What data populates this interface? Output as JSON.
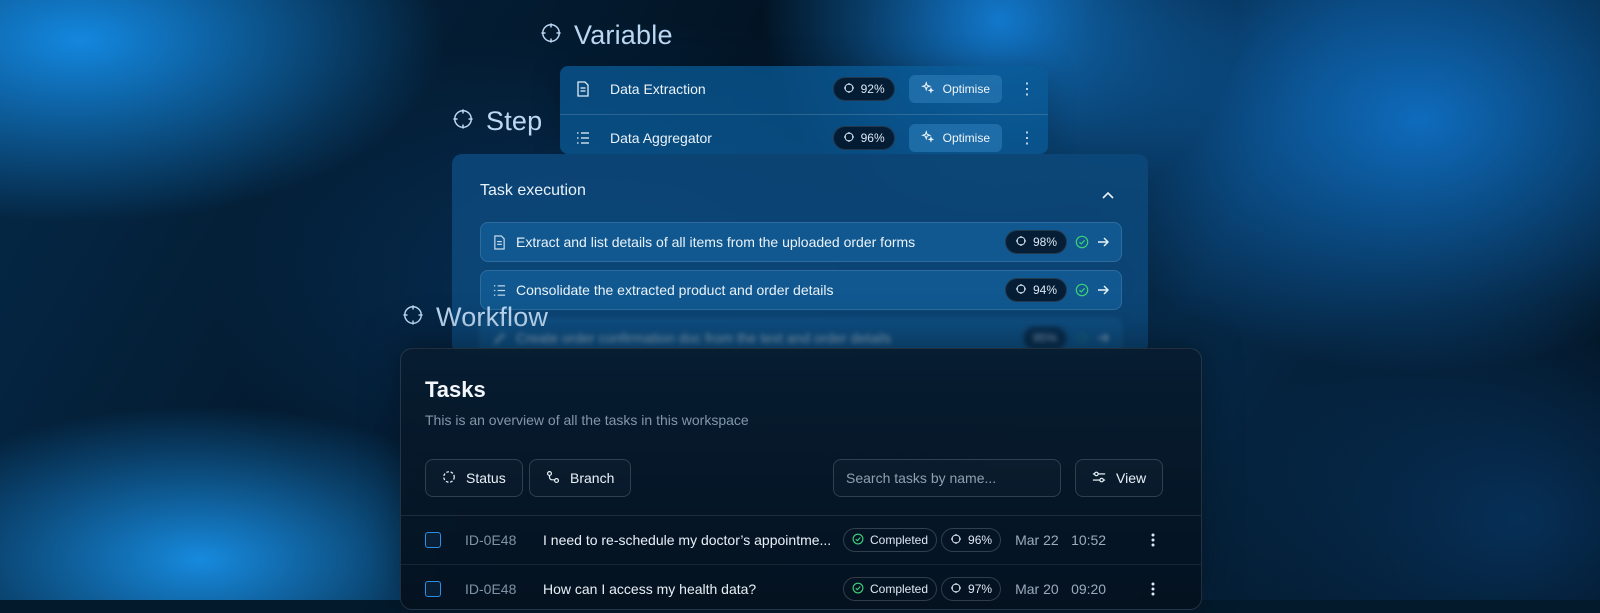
{
  "layers": {
    "variable": "Variable",
    "step": "Step",
    "workflow": "Workflow"
  },
  "variable_card": {
    "rows": [
      {
        "label": "Data Extraction",
        "score": "92%",
        "action": "Optimise",
        "icon": "document-icon"
      },
      {
        "label": "Data Aggregator",
        "score": "96%",
        "action": "Optimise",
        "icon": "list-icon"
      }
    ]
  },
  "step_card": {
    "title": "Task execution",
    "rows": [
      {
        "label": "Extract and list details of all items from the uploaded order forms",
        "score": "98%",
        "icon": "document-icon"
      },
      {
        "label": "Consolidate the extracted product and order details",
        "score": "94%",
        "icon": "list-icon"
      },
      {
        "label": "Create order confirmation doc from the text and order details",
        "score": "95%",
        "icon": "edit-icon"
      }
    ]
  },
  "tasks": {
    "title": "Tasks",
    "subtitle": "This is an overview of all the tasks in this workspace",
    "filters": {
      "status": "Status",
      "branch": "Branch",
      "view": "View"
    },
    "search_placeholder": "Search tasks by name...",
    "rows": [
      {
        "id": "ID-0E48",
        "title": "I need to re-schedule my doctor’s appointme...",
        "status": "Completed",
        "score": "96%",
        "date": "Mar 22",
        "time": "10:52"
      },
      {
        "id": "ID-0E48",
        "title": "How can I access my health data?",
        "status": "Completed",
        "score": "97%",
        "date": "Mar 20",
        "time": "09:20"
      }
    ]
  },
  "colors": {
    "accent": "#2b8fe6",
    "success": "#3ecf7a",
    "panel": "#061a2e"
  }
}
